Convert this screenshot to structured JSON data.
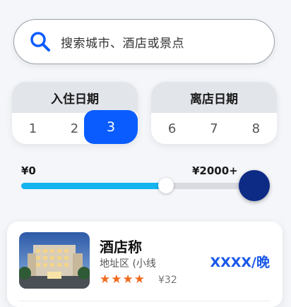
{
  "search": {
    "placeholder": "搜索城市、酒店或景点",
    "icon": "search-icon"
  },
  "checkin": {
    "title": "入住日期",
    "days": [
      "1",
      "2",
      "3"
    ],
    "selected": "3"
  },
  "checkout": {
    "title": "离店日期",
    "days": [
      "6",
      "7",
      "8"
    ]
  },
  "price_filter": {
    "min_label": "¥0",
    "max_label": "¥2000+",
    "fill_fraction": 0.62
  },
  "hotel": {
    "name": "酒店称",
    "address": "地址区 (小线",
    "stars": "★★★★",
    "review": "¥32",
    "price": "XXXX/晚"
  },
  "colors": {
    "accent": "#0a5cff",
    "slider_fill": "#14b4f0",
    "thumb": "#0d2a85",
    "star": "#f06a1d",
    "price": "#1a58e8"
  }
}
